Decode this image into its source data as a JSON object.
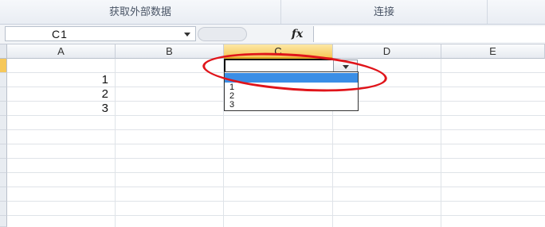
{
  "ribbon": {
    "groups": [
      {
        "label": "获取外部数据"
      },
      {
        "label": "连接"
      }
    ]
  },
  "formula_bar": {
    "name_box": "C1",
    "fx_label": "fx",
    "formula_value": ""
  },
  "columns": [
    "A",
    "B",
    "C",
    "D",
    "E"
  ],
  "active_column": "C",
  "cells": {
    "A2": "1",
    "A3": "2",
    "A4": "3"
  },
  "dropdown": {
    "options": [
      "",
      "1",
      "2",
      "3"
    ],
    "highlighted": ""
  },
  "colors": {
    "active_header": "#f6c85a",
    "highlight": "#3a8ee6",
    "annotation": "#e0141a"
  }
}
